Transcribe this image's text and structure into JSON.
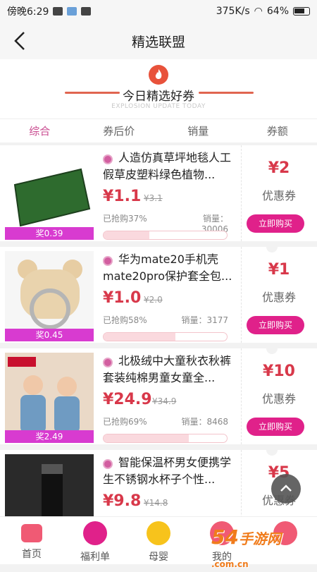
{
  "status": {
    "time": "傍晚6:29",
    "speed": "375K/s",
    "battery": "64%"
  },
  "nav": {
    "title": "精选联盟"
  },
  "banner": {
    "title": "今日精选好券",
    "subtitle": "EXPLOSION UPDATE TODAY"
  },
  "tabs": [
    "综合",
    "券后价",
    "销量",
    "券额"
  ],
  "products": [
    {
      "name": "人造仿真草坪地毯人工假草皮塑料绿色植物...",
      "price": "¥1.1",
      "original": "¥3.1",
      "sold_rate": "已抢购37%",
      "sold_progress": 0.37,
      "sales": "销量：30006",
      "reward": "奖0.39",
      "coupon": "¥2",
      "coupon_label": "优惠券",
      "buy": "立即购买"
    },
    {
      "name": "华为mate20手机壳mate20pro保护套全包...",
      "price": "¥1.0",
      "original": "¥2.0",
      "sold_rate": "已抢购58%",
      "sold_progress": 0.58,
      "sales": "销量：3177",
      "reward": "奖0.45",
      "coupon": "¥1",
      "coupon_label": "优惠券",
      "buy": "立即购买"
    },
    {
      "name": "北极绒中大童秋衣秋裤套装纯棉男童女童全...",
      "price": "¥24.9",
      "original": "¥34.9",
      "sold_rate": "已抢购69%",
      "sold_progress": 0.69,
      "sales": "销量：8468",
      "reward": "奖2.49",
      "coupon": "¥10",
      "coupon_label": "优惠券",
      "buy": "立即购买"
    },
    {
      "name": "智能保温杯男女便携学生不锈钢水杯子个性...",
      "price": "¥9.8",
      "original": "¥14.8",
      "coupon": "¥5",
      "coupon_label": "优惠券"
    }
  ],
  "bottom_nav": [
    "首页",
    "福利单",
    "母婴",
    "我的",
    ""
  ],
  "watermark": {
    "text": "54",
    "site": "手游网",
    "domain": ".com.cn"
  },
  "colors": {
    "accent": "#e0218a",
    "price": "#d8384a",
    "tab_active": "#c94a8f"
  }
}
